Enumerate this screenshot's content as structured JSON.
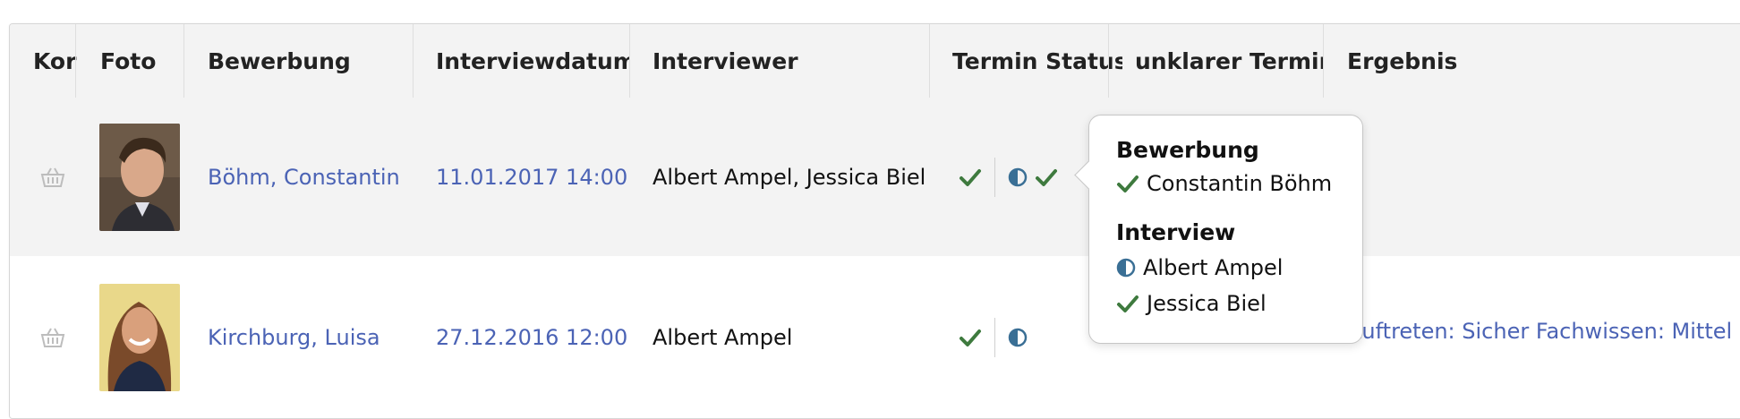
{
  "table": {
    "headers": {
      "kor": "Kor",
      "foto": "Foto",
      "bewerbung": "Bewerbung",
      "interviewdatum": "Interviewdatum",
      "interviewer": "Interviewer",
      "termin_status": "Termin Status",
      "unklarer_termin": "unklarer Termin",
      "ergebnis": "Ergebnis"
    },
    "rows": [
      {
        "name": "Böhm, Constantin",
        "date": "11.01.2017 14:00",
        "interviewers": "Albert Ampel, Jessica Biel",
        "status_icons": [
          "check-icon",
          "half-circle-icon",
          "check-icon"
        ],
        "ergebnis": ""
      },
      {
        "name": "Kirchburg, Luisa",
        "date": "27.12.2016 12:00",
        "interviewers": "Albert Ampel",
        "status_icons": [
          "check-icon",
          "half-circle-icon"
        ],
        "ergebnis": "Auftreten: Sicher Fachwissen: Mittel"
      }
    ]
  },
  "popover": {
    "section1_title": "Bewerbung",
    "section1_items": [
      {
        "icon": "check-icon",
        "label": "Constantin Böhm"
      }
    ],
    "section2_title": "Interview",
    "section2_items": [
      {
        "icon": "half-circle-icon",
        "label": "Albert Ampel"
      },
      {
        "icon": "check-icon",
        "label": "Jessica Biel"
      }
    ]
  },
  "colors": {
    "link": "#4b63b5",
    "check": "#3e7a3e",
    "half": "#3a6f95",
    "row_shade": "#f3f3f3"
  }
}
